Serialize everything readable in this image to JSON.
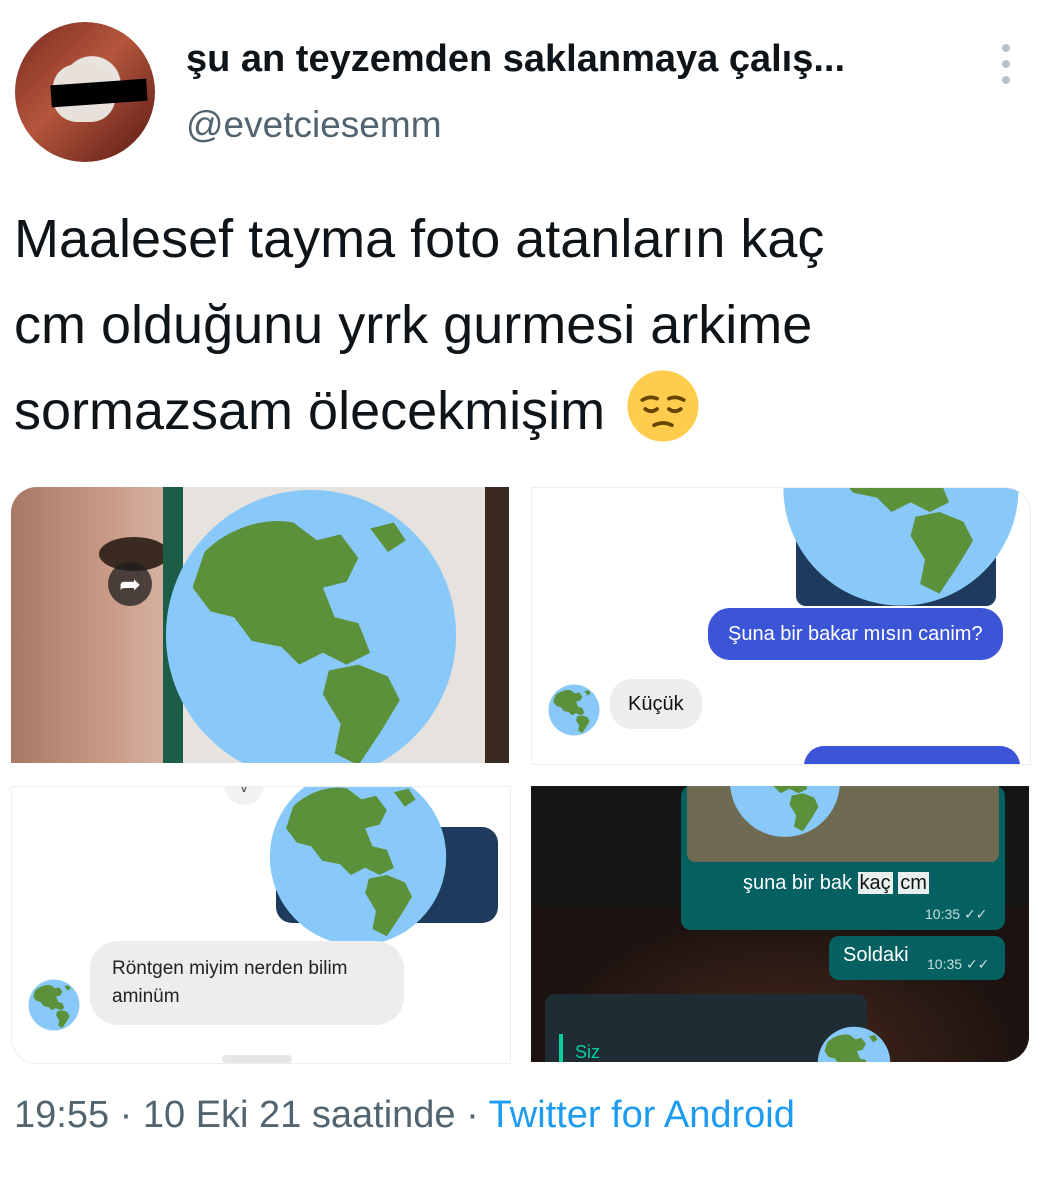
{
  "tweet": {
    "display_name": "şu an teyzemden saklanmaya çalış...",
    "handle": "@evetciesemm",
    "text_line1": "Maalesef tayma foto atanların kaç",
    "text_line2": "cm olduğunu yrrk gurmesi arkime",
    "text_line3": "sormazsam ölecekmişim"
  },
  "icons": {
    "more": "more-vertical-icon",
    "emoji": "pensive-face-emoji",
    "globe": "globe-americas-emoji",
    "share": "share-arrow-icon",
    "read_receipt": "double-check-icon"
  },
  "media": {
    "tile2": {
      "sent": "Şuna bir bakar mısın canim?",
      "reply": "Küçük"
    },
    "tile3": {
      "reply_line1": "Röntgen miyim nerden bilim",
      "reply_line2": "aminüm"
    },
    "tile4": {
      "msg_prefix": "şuna bir bak",
      "msg_hl1": "kaç",
      "msg_hl2": "cm",
      "time1": "10:35",
      "msg2": "Soldaki",
      "time2": "10:35",
      "quote_label": "Siz"
    }
  },
  "footer": {
    "time": "19:55",
    "sep1": " · ",
    "date": "10 Eki 21 saatinde",
    "sep2": " · ",
    "source": "Twitter for Android"
  },
  "colors": {
    "link": "#1d9bf0",
    "muted": "#536471",
    "sent_bubble": "#3b55d6",
    "whatsapp_green": "#056161"
  }
}
